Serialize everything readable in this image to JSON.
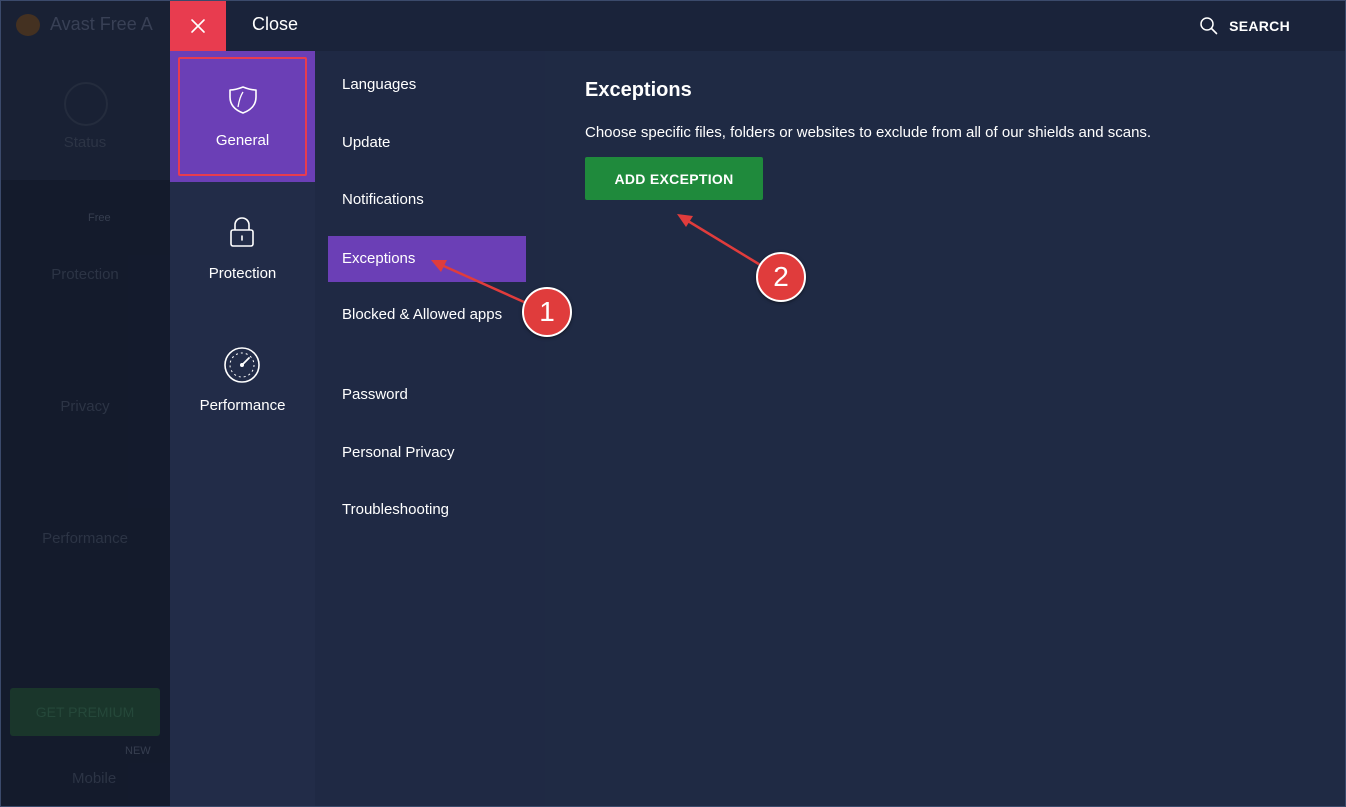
{
  "background_app": {
    "title": "Avast Free A",
    "nav": [
      "Status",
      "Protection",
      "Privacy",
      "Performance"
    ],
    "badge": "Free",
    "upgrade_label": "GET PREMIUM",
    "new_label": "NEW",
    "mobile_label": "Mobile"
  },
  "topbar": {
    "close_label": "Close",
    "search_label": "SEARCH"
  },
  "categories": [
    {
      "label": "General",
      "icon": "shield-icon"
    },
    {
      "label": "Protection",
      "icon": "lock-icon"
    },
    {
      "label": "Performance",
      "icon": "speedometer-icon"
    }
  ],
  "submenu": [
    "Languages",
    "Update",
    "Notifications",
    "Exceptions",
    "Blocked & Allowed apps",
    "Password",
    "Personal Privacy",
    "Troubleshooting"
  ],
  "content": {
    "title": "Exceptions",
    "description": "Choose specific files, folders or websites to exclude from all of our shields and scans.",
    "add_button": "ADD EXCEPTION"
  },
  "annotations": [
    "1",
    "2"
  ],
  "colors": {
    "accent_purple": "#6b3fb6",
    "close_red": "#e83c4f",
    "button_green": "#1f8a3c",
    "annotation_red": "#e03c3c",
    "panel_bg": "#1f2a44"
  }
}
